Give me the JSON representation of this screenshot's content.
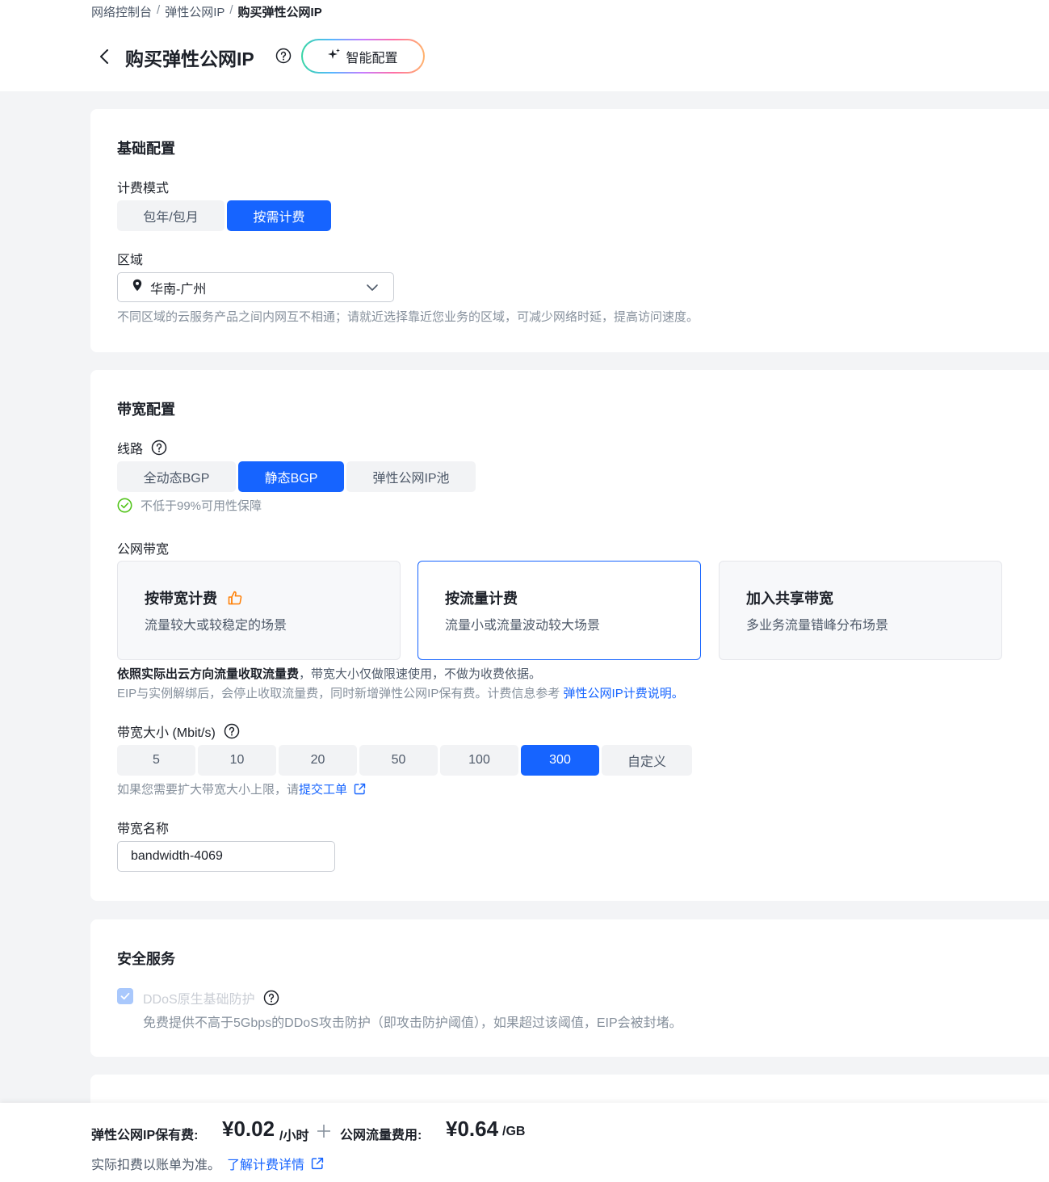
{
  "breadcrumb": {
    "item1": "网络控制台",
    "item2": "弹性公网IP",
    "current": "购买弹性公网IP",
    "sep": "/"
  },
  "header": {
    "title": "购买弹性公网IP",
    "smart_config": "智能配置"
  },
  "basic": {
    "title": "基础配置",
    "billing_label": "计费模式",
    "billing_options": [
      "包年/包月",
      "按需计费"
    ],
    "billing_selected": "按需计费",
    "region_label": "区域",
    "region_value": "华南-广州",
    "region_hint": "不同区域的云服务产品之间内网互不相通；请就近选择靠近您业务的区域，可减少网络时延，提高访问速度。"
  },
  "bandwidth": {
    "title": "带宽配置",
    "line_label": "线路",
    "line_options": [
      "全动态BGP",
      "静态BGP",
      "弹性公网IP池"
    ],
    "line_selected": "静态BGP",
    "sla": "不低于99%可用性保障",
    "public_label": "公网带宽",
    "plans": [
      {
        "title": "按带宽计费",
        "desc": "流量较大或较稳定的场景"
      },
      {
        "title": "按流量计费",
        "desc": "流量小或流量波动较大场景"
      },
      {
        "title": "加入共享带宽",
        "desc": "多业务流量错峰分布场景"
      }
    ],
    "plan_selected": "按流量计费",
    "desc_bold": "依照实际出云方向流量收取流量费",
    "desc_rest": "，带宽大小仅做限速使用，不做为收费依据。",
    "desc2": "EIP与实例解绑后，会停止收取流量费，同时新增弹性公网IP保有费。计费信息参考 ",
    "desc2_link": "弹性公网IP计费说明。",
    "size_label": "带宽大小 (Mbit/s)",
    "size_options": [
      "5",
      "10",
      "20",
      "50",
      "100",
      "300",
      "自定义"
    ],
    "size_selected": "300",
    "size_hint": "如果您需要扩大带宽大小上限，请 ",
    "size_hint_link": "提交工单",
    "name_label": "带宽名称",
    "name_value": "bandwidth-4069"
  },
  "security": {
    "title": "安全服务",
    "ddos_label": "DDoS原生基础防护",
    "ddos_desc": "免费提供不高于5Gbps的DDoS攻击防护（即攻击防护阈值），如果超过该阈值，EIP会被封堵。"
  },
  "footer": {
    "hold_label": "弹性公网IP保有费:",
    "hold_price": "¥0.02",
    "hold_unit": "/小时",
    "plus": "+",
    "traffic_label": "公网流量费用:",
    "traffic_price": "¥0.64",
    "traffic_unit": "/GB",
    "note": "实际扣费以账单为准。",
    "note_link": "了解计费详情"
  },
  "colors": {
    "primary": "#1664ff",
    "success": "#52c41a",
    "text": "#1d2129",
    "muted": "#86909c"
  }
}
